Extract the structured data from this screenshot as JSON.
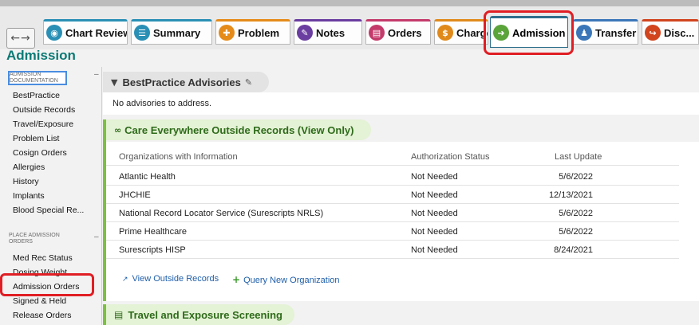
{
  "tabs": [
    {
      "id": "chart-review",
      "label": "Chart Review",
      "icon": "chart-review-icon",
      "color": "#2a8fb5"
    },
    {
      "id": "summary",
      "label": "Summary",
      "icon": "summary-icon",
      "color": "#2a8fb5"
    },
    {
      "id": "problem",
      "label": "Problem",
      "icon": "problem-icon",
      "color": "#e58b1a"
    },
    {
      "id": "notes",
      "label": "Notes",
      "icon": "notes-icon",
      "color": "#6a3da0"
    },
    {
      "id": "orders",
      "label": "Orders",
      "icon": "orders-icon",
      "color": "#c43a6a"
    },
    {
      "id": "charges",
      "label": "Charges",
      "icon": "charges-icon",
      "color": "#e08a1c"
    },
    {
      "id": "admission",
      "label": "Admission",
      "icon": "admission-icon",
      "color": "#5aa43a"
    },
    {
      "id": "transfer",
      "label": "Transfer",
      "icon": "transfer-icon",
      "color": "#3a76b8"
    },
    {
      "id": "discharge",
      "label": "Disc...",
      "icon": "discharge-icon",
      "color": "#d1441e"
    }
  ],
  "activity": {
    "title": "Admission"
  },
  "sidebar": {
    "heading1": "ADMISSION DOCUMENTATION",
    "items1": [
      "BestPractice",
      "Outside Records",
      "Travel/Exposure",
      "Problem List",
      "Cosign Orders",
      "Allergies",
      "History",
      "Implants",
      "Blood Special Re..."
    ],
    "heading2": "PLACE ADMISSION ORDERS",
    "items2": [
      "Med Rec Status",
      "Dosing Weight",
      "Admission Orders",
      "Signed & Held",
      "Release Orders"
    ],
    "collapse_symbol": "–"
  },
  "bpa": {
    "title": "BestPractice Advisories",
    "message": "No advisories to address."
  },
  "care_everywhere": {
    "title": "Care Everywhere Outside Records (View Only)",
    "columns": [
      "Organizations with Information",
      "Authorization Status",
      "Last Update"
    ],
    "rows": [
      {
        "org": "Atlantic Health",
        "status": "Not Needed",
        "date": "5/6/2022"
      },
      {
        "org": "JHCHIE",
        "status": "Not Needed",
        "date": "12/13/2021"
      },
      {
        "org": "National Record Locator Service (Surescripts NRLS)",
        "status": "Not Needed",
        "date": "5/6/2022"
      },
      {
        "org": "Prime Healthcare",
        "status": "Not Needed",
        "date": "5/6/2022"
      },
      {
        "org": "Surescripts HISP",
        "status": "Not Needed",
        "date": "8/24/2021"
      }
    ],
    "view_link": "View Outside Records",
    "query_link": "Query New Organization"
  },
  "travel": {
    "title": "Travel and Exposure Screening"
  },
  "colors": {
    "accent": "#0b7a75",
    "highlight": "#e01e24",
    "section_green": "#7cc142",
    "link": "#1f5faa"
  }
}
